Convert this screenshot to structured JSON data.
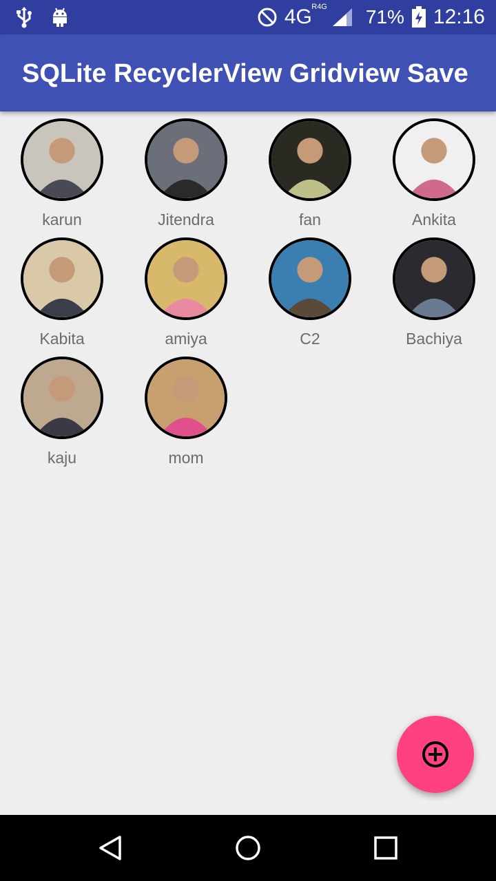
{
  "status_bar": {
    "network": "4G",
    "network_sub": "R4G",
    "battery": "71%",
    "time": "12:16",
    "icons": [
      "usb-icon",
      "android-debug-icon",
      "do-not-disturb-icon",
      "signal-icon",
      "battery-charging-icon"
    ]
  },
  "app_bar": {
    "title": "SQLite RecyclerView Gridview Save"
  },
  "contacts": [
    {
      "name": "karun",
      "colors": [
        "#c9c5bd",
        "#4a4a55"
      ]
    },
    {
      "name": "Jitendra",
      "colors": [
        "#6a6f7a",
        "#2a2a2a"
      ]
    },
    {
      "name": "fan",
      "colors": [
        "#2b2a22",
        "#bfbf8a"
      ]
    },
    {
      "name": "Ankita",
      "colors": [
        "#f0f0f0",
        "#d06a8a"
      ]
    },
    {
      "name": "Kabita",
      "colors": [
        "#d9c9a8",
        "#3a3e48"
      ]
    },
    {
      "name": "amiya",
      "colors": [
        "#d8b86a",
        "#e88aa0"
      ]
    },
    {
      "name": "C2",
      "colors": [
        "#3b7fb0",
        "#5a4a3a"
      ]
    },
    {
      "name": "Bachiya",
      "colors": [
        "#2a2a30",
        "#6a7a90"
      ]
    },
    {
      "name": "kaju",
      "colors": [
        "#bfa890",
        "#3a3a44"
      ]
    },
    {
      "name": "mom",
      "colors": [
        "#c8a070",
        "#e0508a"
      ]
    }
  ],
  "fab": {
    "icon": "add-circle-icon",
    "color": "#ff4081"
  },
  "navigation": {
    "icons": [
      "back-icon",
      "home-icon",
      "recents-icon"
    ]
  },
  "colors": {
    "primary": "#3f51b5",
    "primary_dark": "#303f9f",
    "accent": "#ff4081",
    "background": "#eeeeee"
  }
}
